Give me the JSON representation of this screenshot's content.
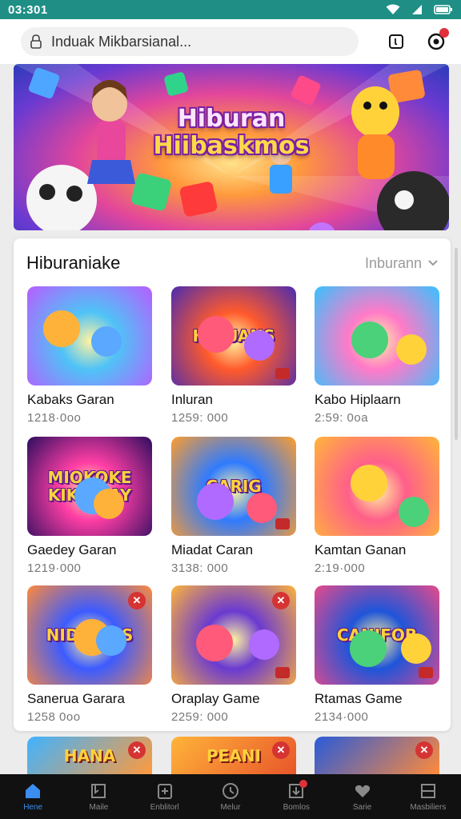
{
  "status_bar": {
    "time": "03:301"
  },
  "search": {
    "value": "Induak Mikbarsianal..."
  },
  "banner": {
    "title_line1": "Hiburan",
    "title_line2": "Hiibaskmos"
  },
  "section": {
    "title": "Hiburaniake",
    "filter_label": "Inburann"
  },
  "games": [
    {
      "name": "Kabaks Garan",
      "meta": "1218·0oo",
      "logo": "",
      "bg": [
        "#4fc3f7",
        "#b85cff"
      ]
    },
    {
      "name": "Inluran",
      "meta": "1259: 000",
      "logo": "HIDUANS",
      "bg": [
        "#ff5a2c",
        "#4a2bb0"
      ]
    },
    {
      "name": "Kabo Hiplaarn",
      "meta": "2:59: 0oa",
      "logo": "",
      "bg": [
        "#ff7ac8",
        "#36c2ff"
      ]
    },
    {
      "name": "Gaedey Garan",
      "meta": "1219·000",
      "logo": "MIOKOKE KIKIAUAY",
      "bg": [
        "#ff3ea5",
        "#2b0d5e"
      ]
    },
    {
      "name": "Miadat Caran",
      "meta": "3138: 000",
      "logo": "CARIG",
      "bg": [
        "#2f7bff",
        "#ff9d2c"
      ]
    },
    {
      "name": "Kamtan Ganan",
      "meta": "2:19·000",
      "logo": "",
      "bg": [
        "#ff5f8a",
        "#ffb63a"
      ]
    },
    {
      "name": "Sanerua Garara",
      "meta": "1258 0oo",
      "logo": "NIDIEROS",
      "bg": [
        "#3c5bff",
        "#ff8a3a"
      ]
    },
    {
      "name": "Oraplay Game",
      "meta": "2259: 000",
      "logo": "",
      "bg": [
        "#6a3ad1",
        "#ffb43a"
      ]
    },
    {
      "name": "Rtamas Game",
      "meta": "2134·000",
      "logo": "CANIFOB",
      "bg": [
        "#1f55d9",
        "#e84a8a"
      ]
    }
  ],
  "peek_games": [
    {
      "logo": "HANA",
      "bg": [
        "#3fb3ff",
        "#ff9a3c"
      ]
    },
    {
      "logo": "PEANI",
      "bg": [
        "#ffb43a",
        "#e8552a"
      ]
    },
    {
      "logo": "",
      "bg": [
        "#2a5bd9",
        "#ff8a3a"
      ]
    }
  ],
  "bottom_nav": [
    {
      "label": "Hene",
      "icon": "home-icon"
    },
    {
      "label": "Maile",
      "icon": "library-icon"
    },
    {
      "label": "Enblitorl",
      "icon": "store-icon"
    },
    {
      "label": "Melur",
      "icon": "clock-icon"
    },
    {
      "label": "Bomlos",
      "icon": "inbox-icon"
    },
    {
      "label": "Sarie",
      "icon": "heart-icon"
    },
    {
      "label": "Masbiliers",
      "icon": "menu-icon"
    }
  ],
  "colors": {
    "status_bar": "#1f8f86",
    "active_nav": "#3b8df0",
    "badge_red": "#e0303a"
  }
}
